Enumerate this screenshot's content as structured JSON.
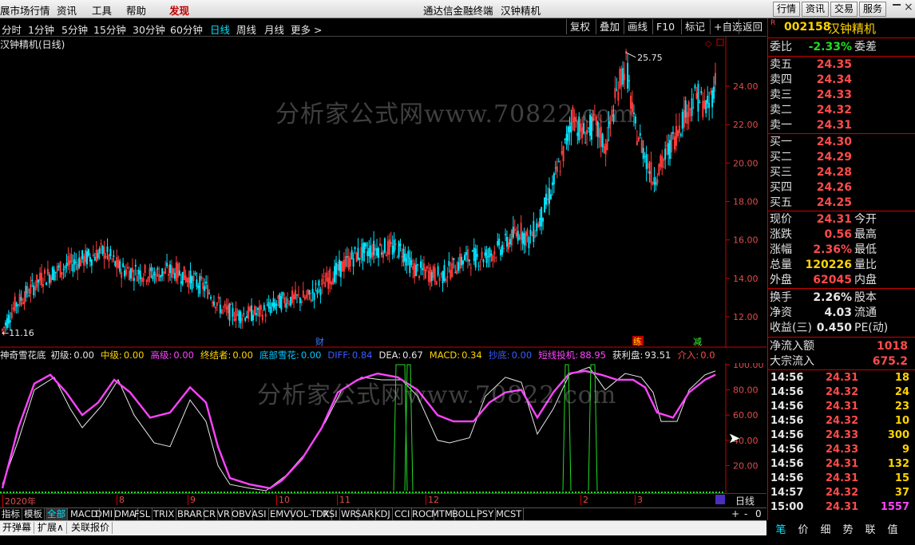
{
  "menubar": {
    "items": [
      "展市场行情",
      "资讯",
      "工具",
      "帮助",
      "发现"
    ],
    "center_title": "通达信金融终端",
    "stock_title": "汉钟精机",
    "right_buttons": [
      "行情",
      "资讯",
      "交易",
      "服务"
    ]
  },
  "periods": [
    "分时",
    "1分钟",
    "5分钟",
    "15分钟",
    "30分钟",
    "60分钟",
    "日线",
    "周线",
    "月线",
    "更多 >"
  ],
  "active_period": "日线",
  "toolbar": [
    "复权",
    "叠加",
    "画线",
    "F10",
    "标记",
    "+自选",
    "返回"
  ],
  "main_chart": {
    "title": "汉钟精机(日线)",
    "high_label": "25.75",
    "low_label": "11.16",
    "y_ticks": [
      "24.00",
      "22.00",
      "20.00",
      "18.00",
      "16.00",
      "14.00",
      "12.00"
    ],
    "markers": [
      "财",
      "练",
      "减"
    ],
    "watermark": "分析家公式网www.70822.com"
  },
  "indicator": {
    "title": "神奇雪花底",
    "fields": [
      {
        "label": "初级:",
        "value": "0.00",
        "color": "#e6e6e6"
      },
      {
        "label": "中级:",
        "value": "0.00",
        "color": "#ffd400"
      },
      {
        "label": "高级:",
        "value": "0.00",
        "color": "#ff44ff"
      },
      {
        "label": "终结者:",
        "value": "0.00",
        "color": "#ffd400"
      },
      {
        "label": "底部雪花:",
        "value": "0.00",
        "color": "#00c8ff"
      },
      {
        "label": "DIFF:",
        "value": "0.84",
        "color": "#3b5bff"
      },
      {
        "label": "DEA:",
        "value": "0.67",
        "color": "#e6e6e6"
      },
      {
        "label": "MACD:",
        "value": "0.34",
        "color": "#ffd400"
      },
      {
        "label": "抄底:",
        "value": "0.00",
        "color": "#3b5bff"
      },
      {
        "label": "短线投机:",
        "value": "88.95",
        "color": "#ff44ff"
      },
      {
        "label": "获利盘:",
        "value": "93.51",
        "color": "#e6e6e6"
      },
      {
        "label": "介入:",
        "value": "0.0",
        "color": "#ff4b4b"
      }
    ],
    "y_ticks": [
      "100.00",
      "80.00",
      "60.00",
      "40.00",
      "20.00"
    ],
    "x_labels": [
      "2020年",
      "8",
      "9",
      "10",
      "11",
      "12",
      "2",
      "3"
    ],
    "period_label": "日线",
    "watermark": "分析家公式网www.70822.com"
  },
  "right_panel": {
    "code": "002158",
    "name": "汉钟精机",
    "weibi_label": "委比",
    "weibi_value": "-2.33%",
    "weicha_label": "委差",
    "sell": [
      {
        "label": "卖五",
        "price": "24.35"
      },
      {
        "label": "卖四",
        "price": "24.34"
      },
      {
        "label": "卖三",
        "price": "24.33"
      },
      {
        "label": "卖二",
        "price": "24.32"
      },
      {
        "label": "卖一",
        "price": "24.31"
      }
    ],
    "buy": [
      {
        "label": "买一",
        "price": "24.30"
      },
      {
        "label": "买二",
        "price": "24.29"
      },
      {
        "label": "买三",
        "price": "24.28"
      },
      {
        "label": "买四",
        "price": "24.26"
      },
      {
        "label": "买五",
        "price": "24.25"
      }
    ],
    "quote": [
      {
        "label": "现价",
        "value": "24.31",
        "label2": "今开",
        "color": "#ff4b4b"
      },
      {
        "label": "涨跌",
        "value": "0.56",
        "label2": "最高",
        "color": "#ff4b4b"
      },
      {
        "label": "涨幅",
        "value": "2.36%",
        "label2": "最低",
        "color": "#ff4b4b"
      },
      {
        "label": "总量",
        "value": "120226",
        "label2": "量比",
        "color": "#ffd400"
      },
      {
        "label": "外盘",
        "value": "62045",
        "label2": "内盘",
        "color": "#ff4b4b"
      }
    ],
    "fund": [
      {
        "label": "换手",
        "value": "2.26%",
        "label2": "股本",
        "color": "#e6e6e6"
      },
      {
        "label": "净资",
        "value": "4.03",
        "label2": "流通",
        "color": "#e6e6e6"
      },
      {
        "label": "收益(三)",
        "value": "0.450",
        "label2": "PE(动)",
        "color": "#e6e6e6"
      }
    ],
    "flow": [
      {
        "label": "净流入额",
        "value": "1018"
      },
      {
        "label": "大宗流入",
        "value": "675.2"
      }
    ],
    "ticks": [
      {
        "time": "14:56",
        "price": "24.31",
        "vol": "18"
      },
      {
        "time": "14:56",
        "price": "24.32",
        "vol": "24"
      },
      {
        "time": "14:56",
        "price": "24.31",
        "vol": "23"
      },
      {
        "time": "14:56",
        "price": "24.32",
        "vol": "10"
      },
      {
        "time": "14:56",
        "price": "24.33",
        "vol": "300"
      },
      {
        "time": "14:56",
        "price": "24.33",
        "vol": "9"
      },
      {
        "time": "14:56",
        "price": "24.31",
        "vol": "132"
      },
      {
        "time": "14:56",
        "price": "24.31",
        "vol": "15"
      },
      {
        "time": "14:57",
        "price": "24.32",
        "vol": "37"
      },
      {
        "time": "15:00",
        "price": "24.31",
        "vol": "1557"
      }
    ],
    "bottom_tabs": [
      "笔",
      "价",
      "细",
      "势",
      "联",
      "值"
    ]
  },
  "indicator_tabs": [
    "指标",
    "模板",
    "全部",
    "MACD",
    "DMI",
    "DMA",
    "FSL",
    "TRIX",
    "BRAR",
    "CR",
    "VR",
    "OBV",
    "ASI",
    "EMV",
    "VOL-TDX",
    "RSI",
    "WR",
    "SAR",
    "KDJ",
    "CCI",
    "ROC",
    "MTM",
    "BOLL",
    "PSY",
    "MCST"
  ],
  "bottom_buttons": [
    "开弹幕",
    "扩展∧",
    "关联报价"
  ],
  "zoom_controls": [
    "+",
    "-",
    "0"
  ],
  "colors": {
    "up": "#ff3b3b",
    "down": "#00e5ff",
    "accent": "#c00000"
  }
}
